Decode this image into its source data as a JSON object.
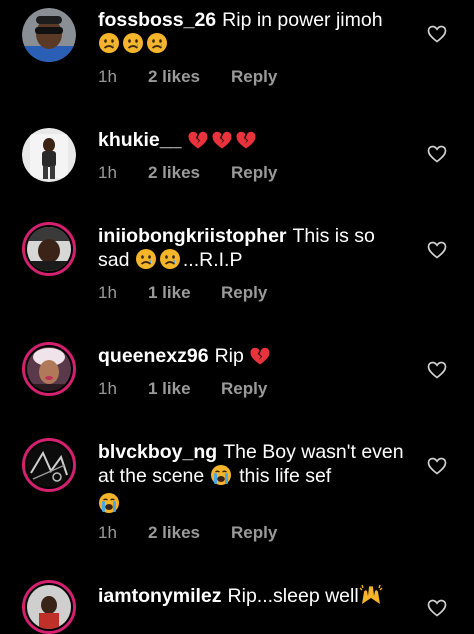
{
  "comments": [
    {
      "username": "fossboss_26",
      "text": "Rip in power jimoh",
      "emojis": [
        "sad-face",
        "sad-face",
        "sad-face"
      ],
      "time": "1h",
      "likes": "2 likes",
      "reply": "Reply"
    },
    {
      "username": "khukie__",
      "text": "",
      "emojis": [
        "broken-heart",
        "broken-heart",
        "broken-heart"
      ],
      "time": "1h",
      "likes": "2 likes",
      "reply": "Reply"
    },
    {
      "username": "iniiobongkriistopher",
      "text_part1": "This is so sad",
      "text_part2": "...R.I.P",
      "emojis": [
        "sad-face",
        "sad-face"
      ],
      "time": "1h",
      "likes": "1 like",
      "reply": "Reply"
    },
    {
      "username": "queenexz96",
      "text": "Rip",
      "emojis": [
        "broken-heart"
      ],
      "time": "1h",
      "likes": "1 like",
      "reply": "Reply"
    },
    {
      "username": "blvckboy_ng",
      "text_part1": "The Boy wasn't even at the scene",
      "text_part2": "this life sef",
      "emojis": [
        "crying-face",
        "crying-face"
      ],
      "time": "1h",
      "likes": "2 likes",
      "reply": "Reply"
    },
    {
      "username": "iamtonymilez",
      "text": "Rip...sleep well",
      "emojis": [
        "raised-hands"
      ]
    }
  ],
  "colors": {
    "background": "#000000",
    "text": "#ffffff",
    "meta": "#9a9a9a",
    "story_ring": "#d3206f",
    "emoji_yellow": "#f5b52b",
    "broken_heart": "#e8323c"
  }
}
